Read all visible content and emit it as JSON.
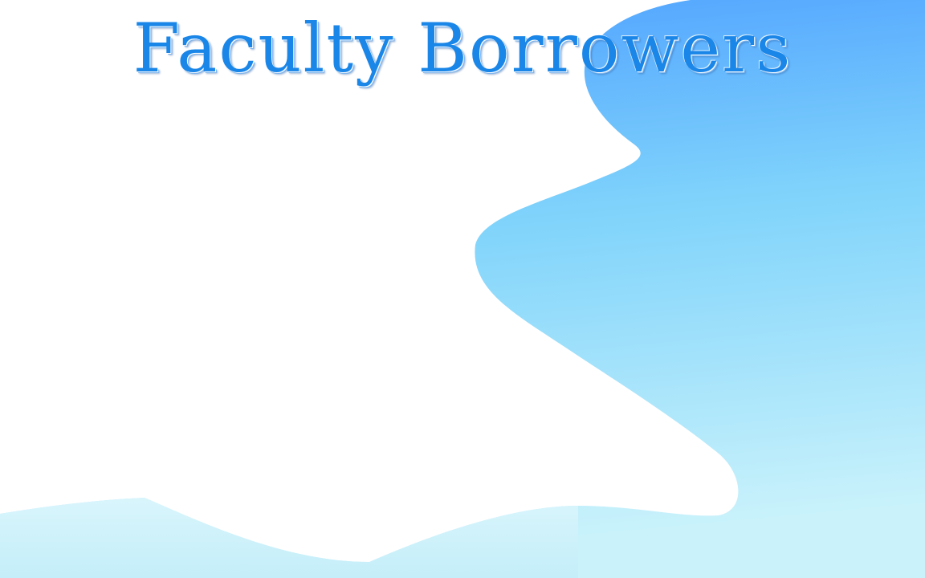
{
  "slide": {
    "title": "Faculty Borrowers"
  },
  "colors": {
    "title": "#1a86e8",
    "wave_top": "#4da0ff",
    "wave_mid": "#7fd3fb",
    "wave_bottom": "#c6f0fb",
    "background": "#ffffff"
  }
}
